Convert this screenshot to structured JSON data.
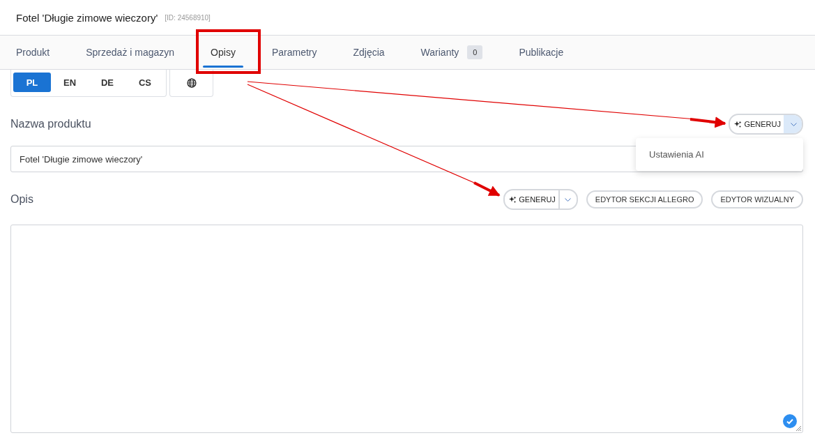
{
  "header": {
    "title": "Fotel 'Długie zimowe wieczory'",
    "id_label": "[ID: 24568910]"
  },
  "tabs": [
    {
      "label": "Produkt",
      "selected": false
    },
    {
      "label": "Sprzedaż i magazyn",
      "selected": false
    },
    {
      "label": "Opisy",
      "selected": true,
      "highlighted": true
    },
    {
      "label": "Parametry",
      "selected": false
    },
    {
      "label": "Zdjęcia",
      "selected": false
    },
    {
      "label": "Warianty",
      "selected": false,
      "badge": "0"
    },
    {
      "label": "Publikacje",
      "selected": false
    }
  ],
  "languages": [
    {
      "label": "PL",
      "selected": true
    },
    {
      "label": "EN",
      "selected": false
    },
    {
      "label": "DE",
      "selected": false
    },
    {
      "label": "CS",
      "selected": false
    }
  ],
  "name_section": {
    "label": "Nazwa produktu",
    "generate": {
      "label": "GENERUJ",
      "menu_open": true
    },
    "menu": [
      "Ustawienia AI"
    ],
    "value": "Fotel 'Długie zimowe wieczory'"
  },
  "description_section": {
    "label": "Opis",
    "generate": {
      "label": "GENERUJ",
      "menu_open": false
    },
    "buttons": [
      "EDYTOR SEKCJI ALLEGRO",
      "EDYTOR WIZUALNY"
    ],
    "valid": true
  }
}
